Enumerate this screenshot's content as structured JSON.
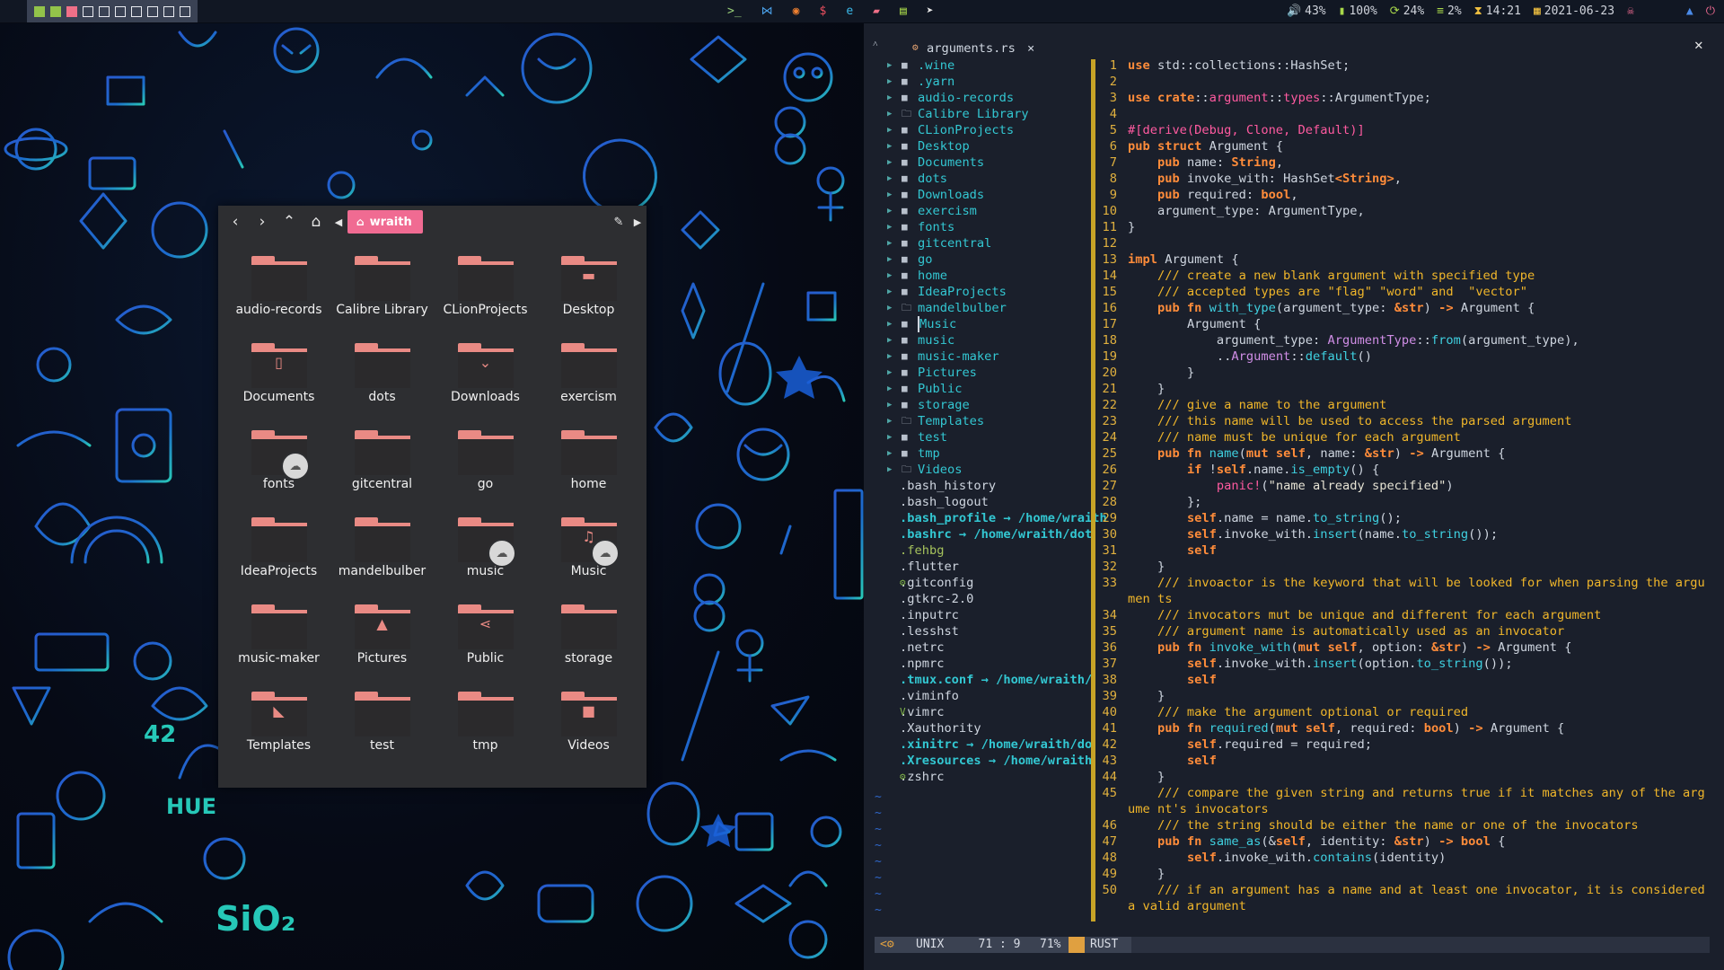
{
  "topbar": {
    "workspaces": [
      {
        "state": "active-green"
      },
      {
        "state": "active-green"
      },
      {
        "state": "active-pink"
      },
      {
        "state": "empty"
      },
      {
        "state": "empty"
      },
      {
        "state": "empty"
      },
      {
        "state": "empty"
      },
      {
        "state": "empty"
      },
      {
        "state": "empty"
      },
      {
        "state": "empty"
      }
    ],
    "apps": [
      "terminal-icon",
      "vscode-icon",
      "firefox-icon",
      "dollar-icon",
      "edge-icon",
      "folder-icon",
      "clipboard-icon",
      "telegram-icon"
    ],
    "status": {
      "volume": "43%",
      "battery": "100%",
      "cpu": "24%",
      "memory": "2%",
      "time": "14:21",
      "date": "2021-06-23"
    }
  },
  "file_manager": {
    "current_folder": "wraith",
    "items": [
      {
        "name": "audio-records",
        "glyph": ""
      },
      {
        "name": "Calibre Library",
        "glyph": ""
      },
      {
        "name": "CLionProjects",
        "glyph": ""
      },
      {
        "name": "Desktop",
        "glyph": "▬"
      },
      {
        "name": "Documents",
        "glyph": "▯"
      },
      {
        "name": "dots",
        "glyph": ""
      },
      {
        "name": "Downloads",
        "glyph": "⌄"
      },
      {
        "name": "exercism",
        "glyph": ""
      },
      {
        "name": "fonts",
        "glyph": "",
        "emblem": "☁"
      },
      {
        "name": "gitcentral",
        "glyph": ""
      },
      {
        "name": "go",
        "glyph": ""
      },
      {
        "name": "home",
        "glyph": ""
      },
      {
        "name": "IdeaProjects",
        "glyph": ""
      },
      {
        "name": "mandelbulber",
        "glyph": ""
      },
      {
        "name": "music",
        "glyph": "",
        "emblem": "☁"
      },
      {
        "name": "Music",
        "glyph": "♫",
        "emblem": "☁"
      },
      {
        "name": "music-maker",
        "glyph": ""
      },
      {
        "name": "Pictures",
        "glyph": "▲"
      },
      {
        "name": "Public",
        "glyph": "⋖"
      },
      {
        "name": "storage",
        "glyph": ""
      },
      {
        "name": "Templates",
        "glyph": "◣"
      },
      {
        "name": "test",
        "glyph": ""
      },
      {
        "name": "tmp",
        "glyph": ""
      },
      {
        "name": "Videos",
        "glyph": "■"
      }
    ]
  },
  "editor": {
    "tab_title": "arguments.rs",
    "close_label": "×",
    "tree": [
      {
        "name": ".wine",
        "kind": "dir"
      },
      {
        "name": ".yarn",
        "kind": "dir"
      },
      {
        "name": "audio-records",
        "kind": "dir"
      },
      {
        "name": "Calibre Library",
        "kind": "dir-open"
      },
      {
        "name": "CLionProjects",
        "kind": "dir"
      },
      {
        "name": "Desktop",
        "kind": "dir"
      },
      {
        "name": "Documents",
        "kind": "dir"
      },
      {
        "name": "dots",
        "kind": "dir"
      },
      {
        "name": "Downloads",
        "kind": "dir"
      },
      {
        "name": "exercism",
        "kind": "dir"
      },
      {
        "name": "fonts",
        "kind": "dir"
      },
      {
        "name": "gitcentral",
        "kind": "dir"
      },
      {
        "name": "go",
        "kind": "dir"
      },
      {
        "name": "home",
        "kind": "dir"
      },
      {
        "name": "IdeaProjects",
        "kind": "dir"
      },
      {
        "name": "mandelbulber",
        "kind": "dir-open"
      },
      {
        "name": "Music",
        "kind": "dir-sel"
      },
      {
        "name": "music",
        "kind": "dir"
      },
      {
        "name": "music-maker",
        "kind": "dir"
      },
      {
        "name": "Pictures",
        "kind": "dir"
      },
      {
        "name": "Public",
        "kind": "dir"
      },
      {
        "name": "storage",
        "kind": "dir"
      },
      {
        "name": "Templates",
        "kind": "dir-open"
      },
      {
        "name": "test",
        "kind": "dir"
      },
      {
        "name": "tmp",
        "kind": "dir"
      },
      {
        "name": "Videos",
        "kind": "dir-open"
      },
      {
        "name": ".bash_history",
        "kind": "file"
      },
      {
        "name": ".bash_logout",
        "kind": "file"
      },
      {
        "name": ".bash_profile → /home/wraith",
        "kind": "link"
      },
      {
        "name": ".bashrc → /home/wraith/dot",
        "kind": "link"
      },
      {
        "name": ".fehbg",
        "kind": "green"
      },
      {
        "name": ".flutter",
        "kind": "file"
      },
      {
        "name": " .gitconfig",
        "kind": "file",
        "prefix": "⚙"
      },
      {
        "name": ".gtkrc-2.0",
        "kind": "file"
      },
      {
        "name": ".inputrc",
        "kind": "file"
      },
      {
        "name": ".lesshst",
        "kind": "file"
      },
      {
        "name": ".netrc",
        "kind": "file"
      },
      {
        "name": ".npmrc",
        "kind": "file"
      },
      {
        "name": ".tmux.conf → /home/wraith/",
        "kind": "link"
      },
      {
        "name": ".viminfo",
        "kind": "file"
      },
      {
        "name": " .vimrc",
        "kind": "file",
        "prefix": "V"
      },
      {
        "name": ".Xauthority",
        "kind": "file"
      },
      {
        "name": ".xinitrc → /home/wraith/do",
        "kind": "link"
      },
      {
        "name": ".Xresources → /home/wraith",
        "kind": "link"
      },
      {
        "name": " .zshrc",
        "kind": "file",
        "prefix": "⚙"
      }
    ],
    "code": [
      {
        "n": "1",
        "t": "<span class='kw'>use</span> std::collections::HashSet;"
      },
      {
        "n": "2",
        "t": ""
      },
      {
        "n": "3",
        "t": "<span class='kw'>use</span> <span class='kw'>crate</span>::<span class='mc'>argument</span>::<span class='mc'>types</span>::ArgumentType;"
      },
      {
        "n": "4",
        "t": ""
      },
      {
        "n": "5",
        "t": "<span class='mc'>#[derive(Debug, Clone, Default)]</span>"
      },
      {
        "n": "6",
        "t": "<span class='kw'>pub struct</span> Argument {"
      },
      {
        "n": "7",
        "t": "    <span class='kw'>pub</span> name: <span class='kw'>String</span>,"
      },
      {
        "n": "8",
        "t": "    <span class='kw'>pub</span> invoke_with: HashSet<span class='kw'>&lt;String&gt;</span>,"
      },
      {
        "n": "9",
        "t": "    <span class='kw'>pub</span> required: <span class='kw'>bool</span>,"
      },
      {
        "n": "10",
        "t": "    argument_type: ArgumentType,"
      },
      {
        "n": "11",
        "t": "}"
      },
      {
        "n": "12",
        "t": ""
      },
      {
        "n": "13",
        "t": "<span class='kw'>impl</span> Argument {"
      },
      {
        "n": "14",
        "t": "    <span class='cm'>/// create a new blank argument with specified type</span>"
      },
      {
        "n": "15",
        "t": "    <span class='cm'>/// accepted types are \"flag\" \"word\" and  \"vector\"</span>"
      },
      {
        "n": "16",
        "t": "    <span class='kw'>pub fn</span> <span class='fn'>with_type</span>(argument_type: <span class='kw'>&amp;str</span>) <span class='kw'>-&gt;</span> Argument {"
      },
      {
        "n": "17",
        "t": "        Argument {"
      },
      {
        "n": "18",
        "t": "            argument_type: <span class='ty'>ArgumentType</span>::<span class='fn'>from</span>(argument_type),"
      },
      {
        "n": "19",
        "t": "            ..<span class='ty'>Argument</span>::<span class='fn'>default</span>()"
      },
      {
        "n": "20",
        "t": "        }"
      },
      {
        "n": "21",
        "t": "    }"
      },
      {
        "n": "22",
        "t": "    <span class='cm'>/// give a name to the argument</span>"
      },
      {
        "n": "23",
        "t": "    <span class='cm'>/// this name will be used to access the parsed argument</span>"
      },
      {
        "n": "24",
        "t": "    <span class='cm'>/// name must be unique for each argument</span>"
      },
      {
        "n": "25",
        "t": "    <span class='kw'>pub fn</span> <span class='fn'>name</span>(<span class='kw'>mut</span> <span class='kw'>self</span>, name: <span class='kw'>&amp;str</span>) <span class='kw'>-&gt;</span> Argument {"
      },
      {
        "n": "26",
        "t": "        <span class='kw'>if</span> !<span class='kw'>self</span>.name.<span class='fn'>is_empty</span>() {"
      },
      {
        "n": "27",
        "t": "            <span class='mc'>panic!</span>(<span class='st'>\"name already specified\"</span>)"
      },
      {
        "n": "28",
        "t": "        };"
      },
      {
        "n": "29",
        "t": "        <span class='kw'>self</span>.name = name.<span class='fn'>to_string</span>();"
      },
      {
        "n": "30",
        "t": "        <span class='kw'>self</span>.invoke_with.<span class='fn'>insert</span>(name.<span class='fn'>to_string</span>());"
      },
      {
        "n": "31",
        "t": "        <span class='kw'>self</span>"
      },
      {
        "n": "32",
        "t": "    }"
      },
      {
        "n": "33",
        "t": "    <span class='cm'>/// invoactor is the keyword that will be looked for when parsing the argumen ts</span>"
      },
      {
        "n": "34",
        "t": "    <span class='cm'>/// invocators mut be unique and different for each argument</span>"
      },
      {
        "n": "35",
        "t": "    <span class='cm'>/// argument name is automatically used as an invocator</span>"
      },
      {
        "n": "36",
        "t": "    <span class='kw'>pub fn</span> <span class='fn'>invoke_with</span>(<span class='kw'>mut</span> <span class='kw'>self</span>, option: <span class='kw'>&amp;str</span>) <span class='kw'>-&gt;</span> Argument {"
      },
      {
        "n": "37",
        "t": "        <span class='kw'>self</span>.invoke_with.<span class='fn'>insert</span>(option.<span class='fn'>to_string</span>());"
      },
      {
        "n": "38",
        "t": "        <span class='kw'>self</span>"
      },
      {
        "n": "39",
        "t": "    }"
      },
      {
        "n": "40",
        "t": "    <span class='cm'>/// make the argument optional or required</span>"
      },
      {
        "n": "41",
        "t": "    <span class='kw'>pub fn</span> <span class='fn'>required</span>(<span class='kw'>mut</span> <span class='kw'>self</span>, required: <span class='kw'>bool</span>) <span class='kw'>-&gt;</span> Argument {"
      },
      {
        "n": "42",
        "t": "        <span class='kw'>self</span>.required = required;"
      },
      {
        "n": "43",
        "t": "        <span class='kw'>self</span>"
      },
      {
        "n": "44",
        "t": "    }"
      },
      {
        "n": "45",
        "t": "    <span class='cm'>/// compare the given string and returns true if it matches any of the argume nt's invocators</span>"
      },
      {
        "n": "46",
        "t": "    <span class='cm'>/// the string should be either the name or one of the invocators</span>"
      },
      {
        "n": "47",
        "t": "    <span class='kw'>pub fn</span> <span class='fn'>same_as</span>(&amp;<span class='kw'>self</span>, identity: <span class='kw'>&amp;str</span>) <span class='kw'>-&gt;</span> <span class='kw'>bool</span> {"
      },
      {
        "n": "48",
        "t": "        <span class='kw'>self</span>.invoke_with.<span class='fn'>contains</span>(identity)"
      },
      {
        "n": "49",
        "t": "    }"
      },
      {
        "n": "50",
        "t": "    <span class='cm'>/// if an argument has a name and at least one invocator, it is considered a valid argument</span>"
      }
    ],
    "statusline": {
      "mode": "",
      "format": "UNIX",
      "position": "71 : 9",
      "percent": "71%",
      "filetype": "RUST"
    }
  }
}
